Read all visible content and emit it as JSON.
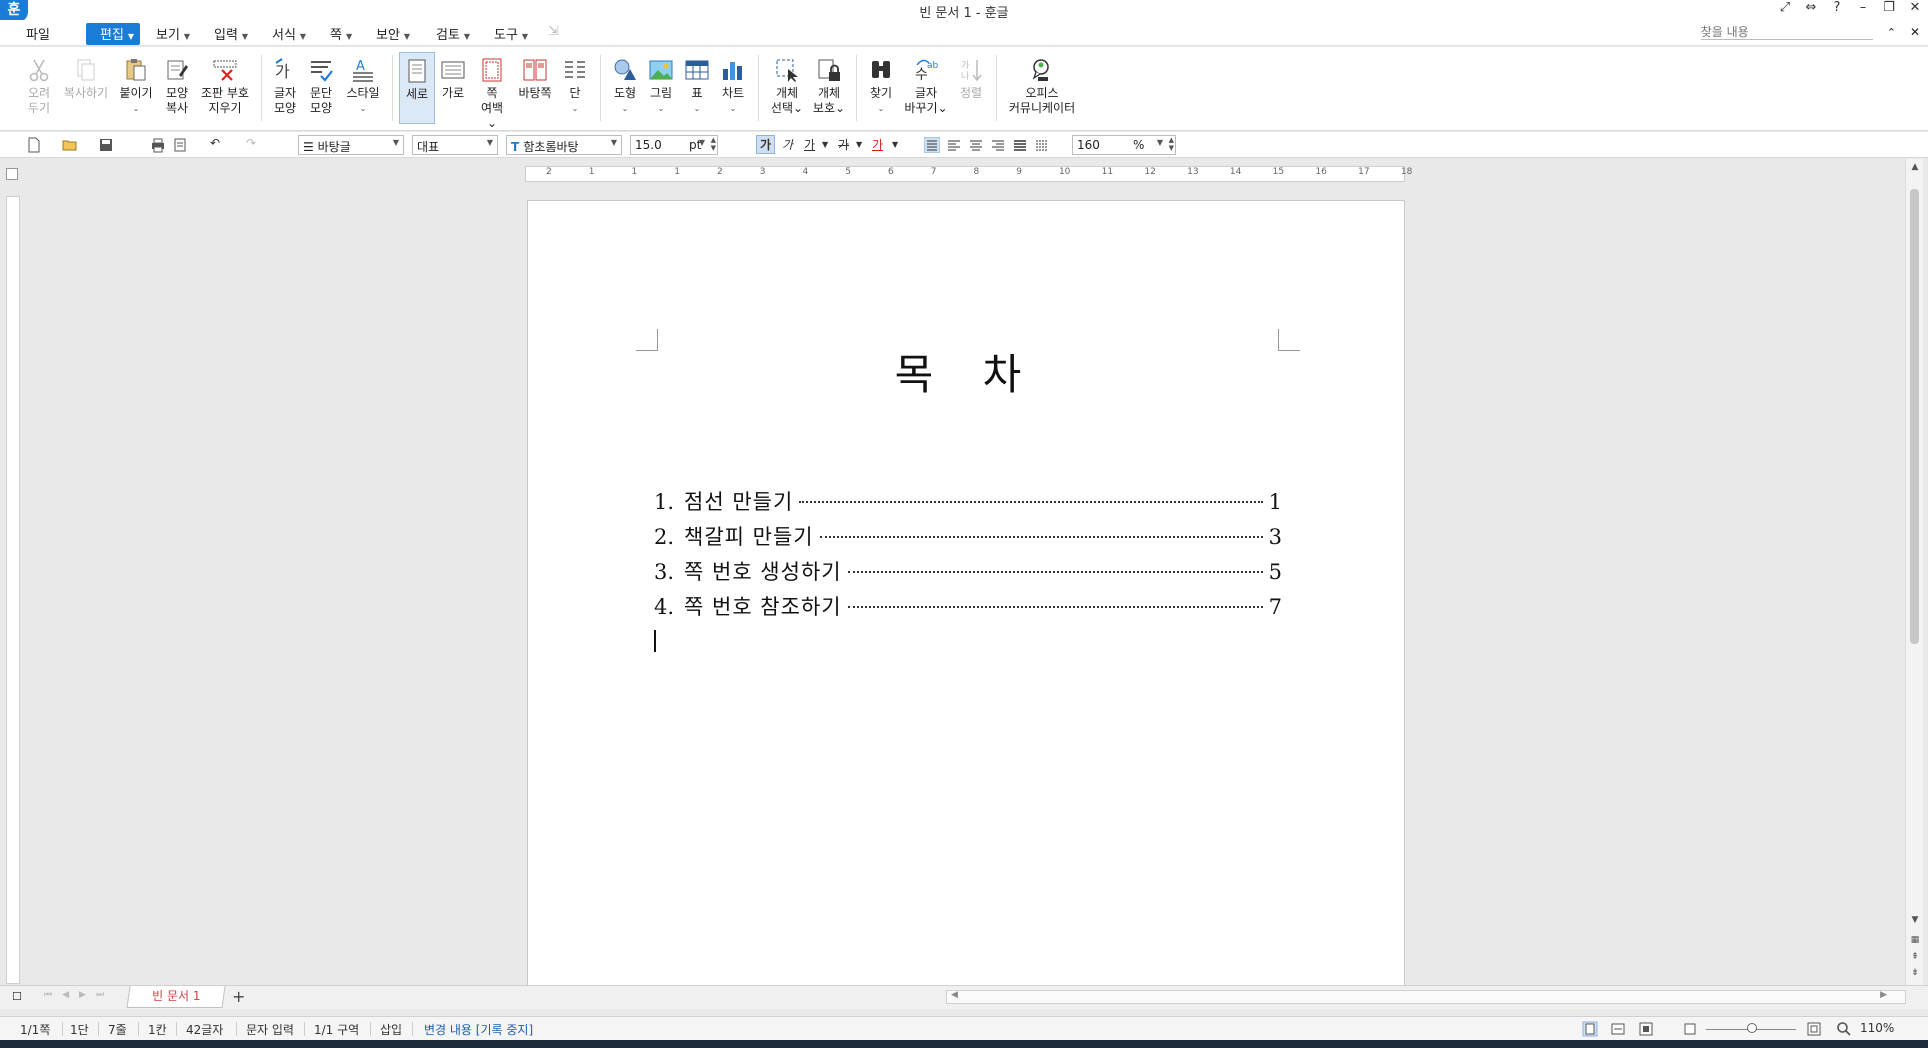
{
  "window": {
    "logo": "훈",
    "title": "빈 문서 1 - 훈글",
    "controls": [
      "⤢",
      "⇔",
      "?",
      "–",
      "❐",
      "✕"
    ]
  },
  "menu": {
    "items": [
      {
        "label": "파일",
        "caret": false
      },
      {
        "label": "편집",
        "caret": true,
        "active": true
      },
      {
        "label": "보기",
        "caret": true
      },
      {
        "label": "입력",
        "caret": true
      },
      {
        "label": "서식",
        "caret": true
      },
      {
        "label": "쪽",
        "caret": true
      },
      {
        "label": "보안",
        "caret": true
      },
      {
        "label": "검토",
        "caret": true
      },
      {
        "label": "도구",
        "caret": true
      }
    ],
    "search_placeholder": "찾을 내용"
  },
  "ribbon": {
    "buttons": [
      {
        "label1": "오려",
        "label2": "두기",
        "disabled": true,
        "icon": "scissors-icon"
      },
      {
        "label1": "복사하기",
        "label2": "",
        "disabled": true,
        "icon": "copy-icon"
      },
      {
        "label1": "붙이기",
        "label2": "⌄",
        "disabled": false,
        "icon": "paste-icon"
      },
      {
        "label1": "모양",
        "label2": "복사",
        "disabled": false,
        "icon": "format-painter-icon"
      },
      {
        "label1": "조판 부호",
        "label2": "지우기",
        "disabled": false,
        "icon": "clear-codes-icon"
      },
      {
        "label1": "글자",
        "label2": "모양",
        "disabled": false,
        "icon": "char-shape-icon"
      },
      {
        "label1": "문단",
        "label2": "모양",
        "disabled": false,
        "icon": "para-shape-icon"
      },
      {
        "label1": "스타일",
        "label2": "⌄",
        "disabled": false,
        "icon": "style-icon"
      },
      {
        "label1": "세로",
        "label2": "",
        "disabled": false,
        "active": true,
        "icon": "portrait-icon"
      },
      {
        "label1": "가로",
        "label2": "",
        "disabled": false,
        "icon": "landscape-icon"
      },
      {
        "label1": "쪽",
        "label2": "여백⌄",
        "disabled": false,
        "icon": "page-margin-icon"
      },
      {
        "label1": "바탕쪽",
        "label2": "",
        "disabled": false,
        "icon": "master-page-icon"
      },
      {
        "label1": "단",
        "label2": "⌄",
        "disabled": false,
        "icon": "columns-icon"
      },
      {
        "label1": "도형",
        "label2": "⌄",
        "disabled": false,
        "icon": "shapes-icon"
      },
      {
        "label1": "그림",
        "label2": "⌄",
        "disabled": false,
        "icon": "picture-icon"
      },
      {
        "label1": "표",
        "label2": "⌄",
        "disabled": false,
        "icon": "table-icon"
      },
      {
        "label1": "차트",
        "label2": "⌄",
        "disabled": false,
        "icon": "chart-icon"
      },
      {
        "label1": "개체",
        "label2": "선택⌄",
        "disabled": false,
        "icon": "select-object-icon"
      },
      {
        "label1": "개체",
        "label2": "보호⌄",
        "disabled": false,
        "icon": "protect-object-icon"
      },
      {
        "label1": "찾기",
        "label2": "⌄",
        "disabled": false,
        "icon": "binoculars-icon"
      },
      {
        "label1": "글자",
        "label2": "바꾸기⌄",
        "disabled": false,
        "icon": "replace-icon"
      },
      {
        "label1": "정렬",
        "label2": "",
        "disabled": true,
        "icon": "sort-icon"
      },
      {
        "label1": "오피스",
        "label2": "커뮤니케이터",
        "disabled": false,
        "icon": "communicator-icon"
      }
    ]
  },
  "format": {
    "style": "바탕글",
    "lang": "대표",
    "font": "함초롬바탕",
    "size": "15.0",
    "unit": "pt",
    "bold": "가",
    "italic": "가",
    "underline": "가",
    "strike": "가",
    "color": "가",
    "zoom_value": "160",
    "zoom_unit": "%"
  },
  "ruler": {
    "numbers": [
      "2",
      "1",
      "1",
      "1",
      "2",
      "3",
      "4",
      "5",
      "6",
      "7",
      "8",
      "9",
      "10",
      "11",
      "12",
      "13",
      "14",
      "15",
      "16",
      "17",
      "18"
    ]
  },
  "document": {
    "title": "목 차",
    "toc": [
      {
        "num": "1.",
        "text": "점선 만들기",
        "page": "1"
      },
      {
        "num": "2.",
        "text": "책갈피 만들기",
        "page": "3"
      },
      {
        "num": "3.",
        "text": "쪽 번호 생성하기",
        "page": "5"
      },
      {
        "num": "4.",
        "text": "쪽 번호 참조하기",
        "page": "7"
      }
    ]
  },
  "tabs": {
    "doc_tab": "빈 문서 1",
    "add": "+"
  },
  "status": {
    "page": "1/1쪽",
    "column": "1단",
    "line": "7줄",
    "cell": "1칸",
    "chars": "42글자",
    "mode": "문자 입력",
    "section": "1/1 구역",
    "insert": "삽입",
    "track": "변경 내용 [기록 중지]",
    "zoom": "110%"
  },
  "colors": {
    "accent": "#1a7cd6",
    "tab_text": "#d04040",
    "status_link": "#1a5fb4"
  }
}
